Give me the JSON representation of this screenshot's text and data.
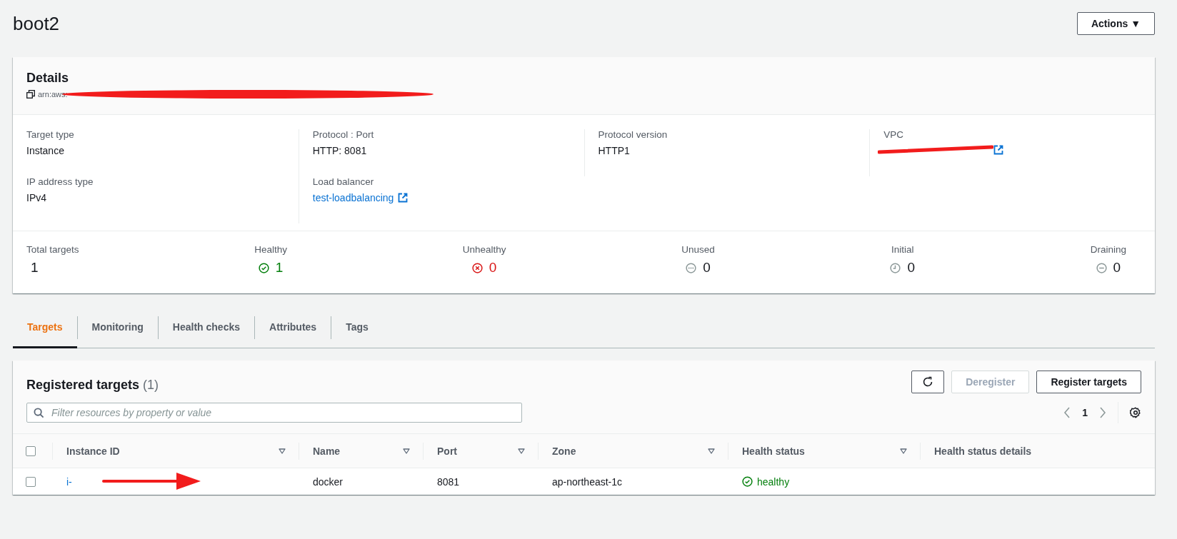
{
  "page": {
    "title": "boot2",
    "actions_button": "Actions ▼"
  },
  "details": {
    "title": "Details",
    "arn": "arn:aws:",
    "fields": [
      {
        "label": "Target type",
        "value": "Instance",
        "kind": "text"
      },
      {
        "label": "Protocol : Port",
        "value": "HTTP: 8081",
        "kind": "text"
      },
      {
        "label": "Protocol version",
        "value": "HTTP1",
        "kind": "text"
      },
      {
        "label": "VPC",
        "kind": "redacted-link"
      },
      {
        "label": "IP address type",
        "value": "IPv4",
        "kind": "text"
      },
      {
        "label": "Load balancer",
        "value": "test-loadbalancing",
        "kind": "link"
      }
    ],
    "stats": [
      {
        "label": "Total targets",
        "value": "1",
        "kind": "total"
      },
      {
        "label": "Healthy",
        "value": "1",
        "kind": "healthy"
      },
      {
        "label": "Unhealthy",
        "value": "0",
        "kind": "unhealthy"
      },
      {
        "label": "Unused",
        "value": "0",
        "kind": "unused"
      },
      {
        "label": "Initial",
        "value": "0",
        "kind": "initial"
      },
      {
        "label": "Draining",
        "value": "0",
        "kind": "draining"
      }
    ]
  },
  "tabs": [
    {
      "label": "Targets",
      "selected": true
    },
    {
      "label": "Monitoring",
      "selected": false
    },
    {
      "label": "Health checks",
      "selected": false
    },
    {
      "label": "Attributes",
      "selected": false
    },
    {
      "label": "Tags",
      "selected": false
    }
  ],
  "targets": {
    "title": "Registered targets",
    "count": "(1)",
    "buttons": [
      {
        "label": "Deregister",
        "disabled": true
      },
      {
        "label": "Register targets",
        "disabled": false
      }
    ],
    "filter": {
      "placeholder": "Filter resources by property or value"
    },
    "page": "1",
    "select_all_checked": false,
    "columns": [
      {
        "label": "Instance ID",
        "sortable": true
      },
      {
        "label": "Name",
        "sortable": true
      },
      {
        "label": "Port",
        "sortable": true
      },
      {
        "label": "Zone",
        "sortable": true
      },
      {
        "label": "Health status",
        "sortable": true
      },
      {
        "label": "Health status details",
        "sortable": false
      }
    ],
    "rows": [
      {
        "checked": false,
        "instance_id": "i-",
        "name": "docker",
        "port": "8081",
        "zone": "ap-northeast-1c",
        "health": "healthy"
      }
    ]
  }
}
